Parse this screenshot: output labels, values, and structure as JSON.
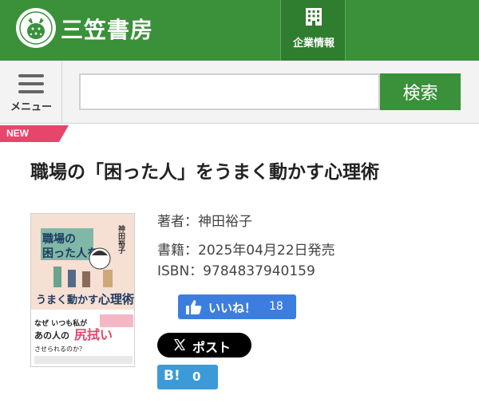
{
  "header": {
    "logo_text": "三笠書房",
    "corporate_label": "企業情報",
    "brand_color": "#3a913a",
    "logo_icon": "deer-emblem-icon",
    "corporate_icon": "building-icon"
  },
  "search": {
    "menu_label": "メニュー",
    "menu_icon": "hamburger-icon",
    "input_value": "",
    "button_label": "検索"
  },
  "book": {
    "badge": "NEW",
    "badge_color": "#e8456b",
    "title": "職場の「困った人」をうまく動かす心理術",
    "author_line": "著者：神田裕子",
    "publish_line": "書籍：2025年04月22日発売",
    "isbn_line": "ISBN：9784837940159"
  },
  "social": {
    "like_label": "いいね！",
    "like_count": "18",
    "like_color": "#3b7ee0",
    "post_label": "ポスト",
    "post_icon": "x-logo-icon",
    "hatena_icon_text": "B!",
    "hatena_count": "0",
    "hatena_color": "#3d9ad8"
  }
}
